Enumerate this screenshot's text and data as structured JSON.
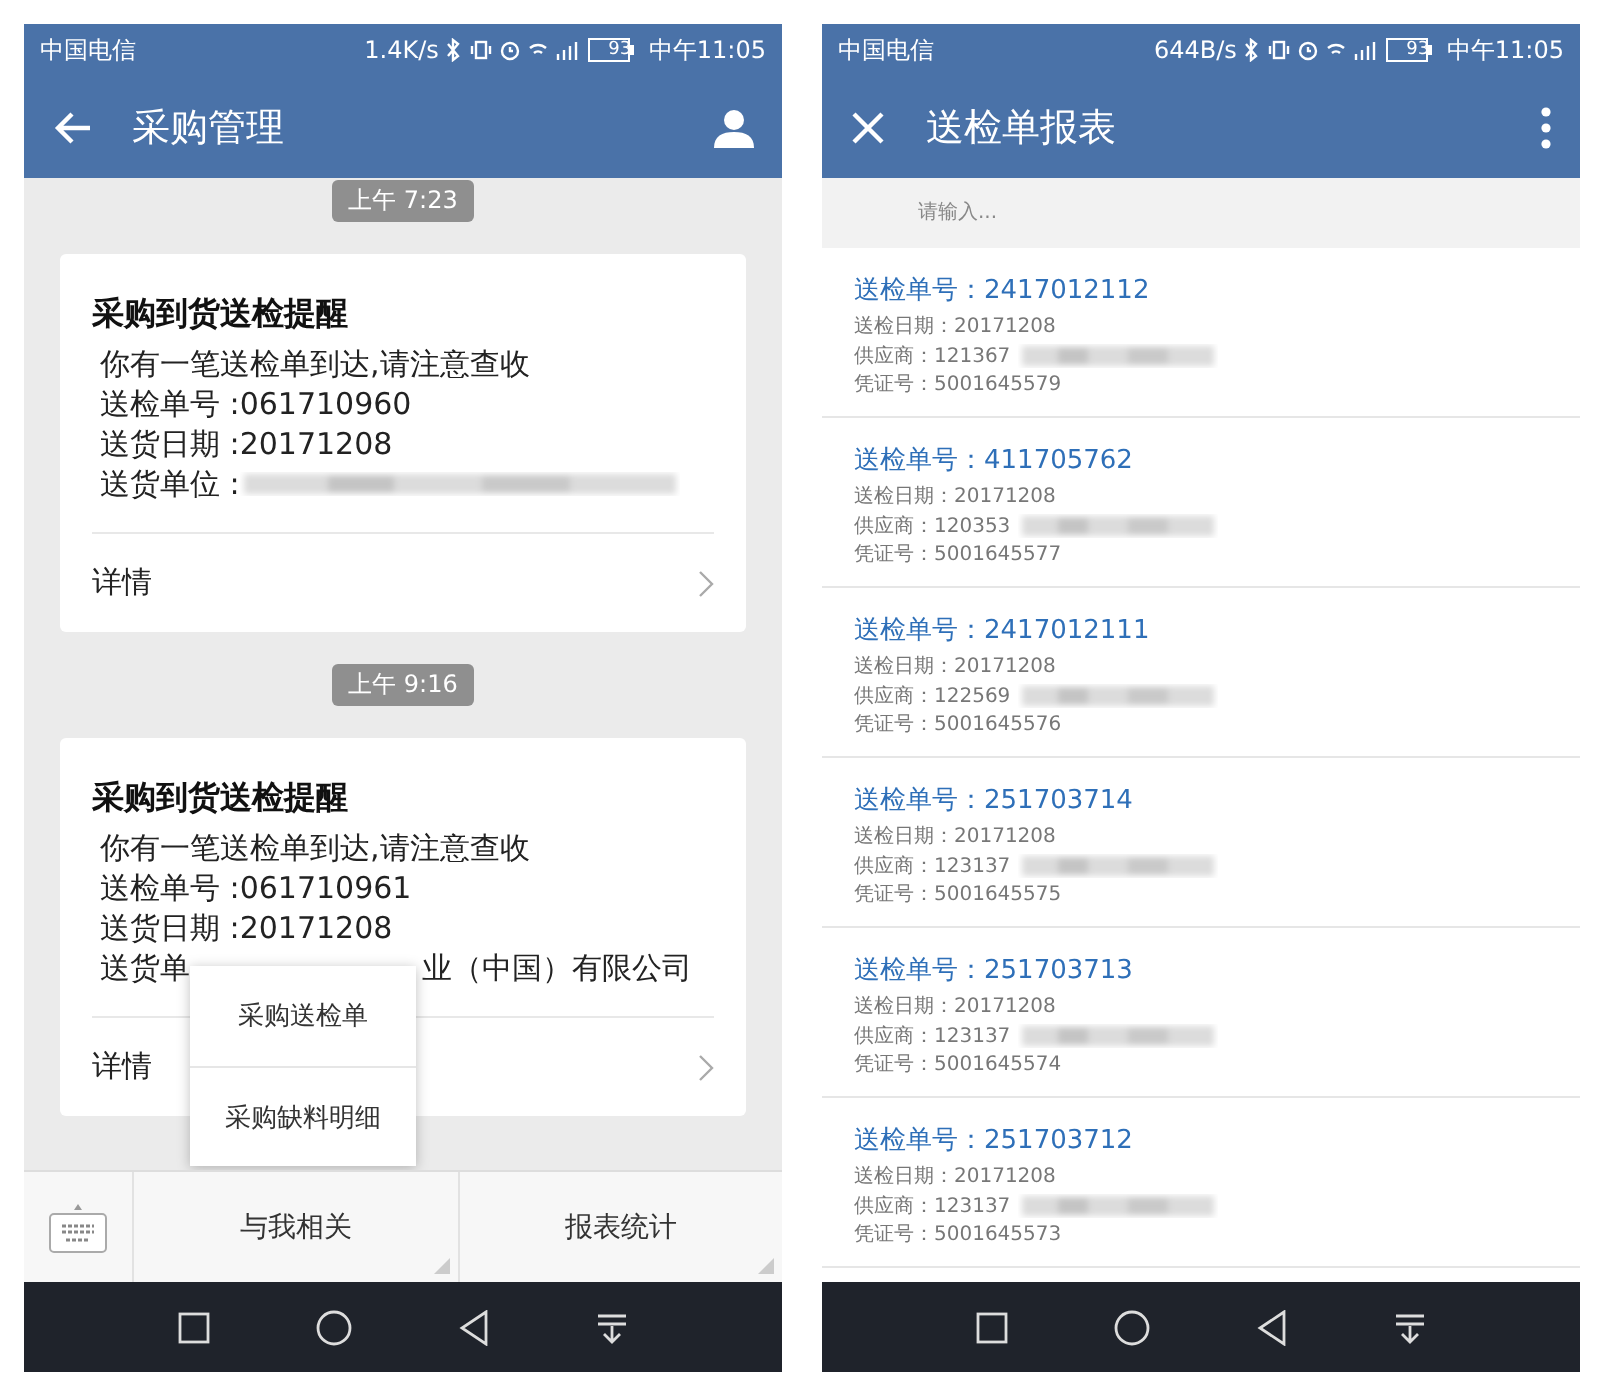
{
  "phones": [
    {
      "kind": "chat",
      "status_bar": {
        "carrier": "中国电信",
        "speed": "1.4K/s",
        "battery": "93",
        "time": "中午11:05"
      },
      "header": {
        "title": "采购管理"
      },
      "messages": [
        {
          "time": "上午 7:23",
          "title": "采购到货送检提醒",
          "lines": [
            "你有一笔送检单到达,请注意查收",
            "送检单号 :061710960",
            "送货日期 :20171208"
          ],
          "supplier": {
            "parts": [
              "送货单位 :"
            ],
            "redacted": true
          },
          "details": "详情"
        },
        {
          "time": "上午 9:16",
          "title": "采购到货送检提醒",
          "lines": [
            "你有一笔送检单到达,请注意查收",
            "送检单号 :061710961",
            "送货日期 :20171208"
          ],
          "supplier": {
            "parts": [
              "送货单",
              "业（中国）有限公司"
            ],
            "redacted": false
          },
          "details": "详情"
        }
      ],
      "popup_menu": [
        "采购送检单",
        "采购缺料明细"
      ],
      "bottom_menu": [
        "与我相关",
        "报表统计"
      ]
    },
    {
      "kind": "report",
      "status_bar": {
        "carrier": "中国电信",
        "speed": "644B/s",
        "battery": "93",
        "time": "中午11:05"
      },
      "header": {
        "title": "送检单报表"
      },
      "search": {
        "placeholder": "请输入..."
      },
      "items": [
        {
          "number": "送检单号：2417012112",
          "date": "送检日期：20171208",
          "supplier": "供应商：121367",
          "voucher": "凭证号：5001645579"
        },
        {
          "number": "送检单号：411705762",
          "date": "送检日期：20171208",
          "supplier": "供应商：120353",
          "voucher": "凭证号：5001645577"
        },
        {
          "number": "送检单号：2417012111",
          "date": "送检日期：20171208",
          "supplier": "供应商：122569",
          "voucher": "凭证号：5001645576"
        },
        {
          "number": "送检单号：251703714",
          "date": "送检日期：20171208",
          "supplier": "供应商：123137",
          "voucher": "凭证号：5001645575"
        },
        {
          "number": "送检单号：251703713",
          "date": "送检日期：20171208",
          "supplier": "供应商：123137",
          "voucher": "凭证号：5001645574"
        },
        {
          "number": "送检单号：251703712",
          "date": "送检日期：20171208",
          "supplier": "供应商：123137",
          "voucher": "凭证号：5001645573"
        }
      ]
    }
  ]
}
